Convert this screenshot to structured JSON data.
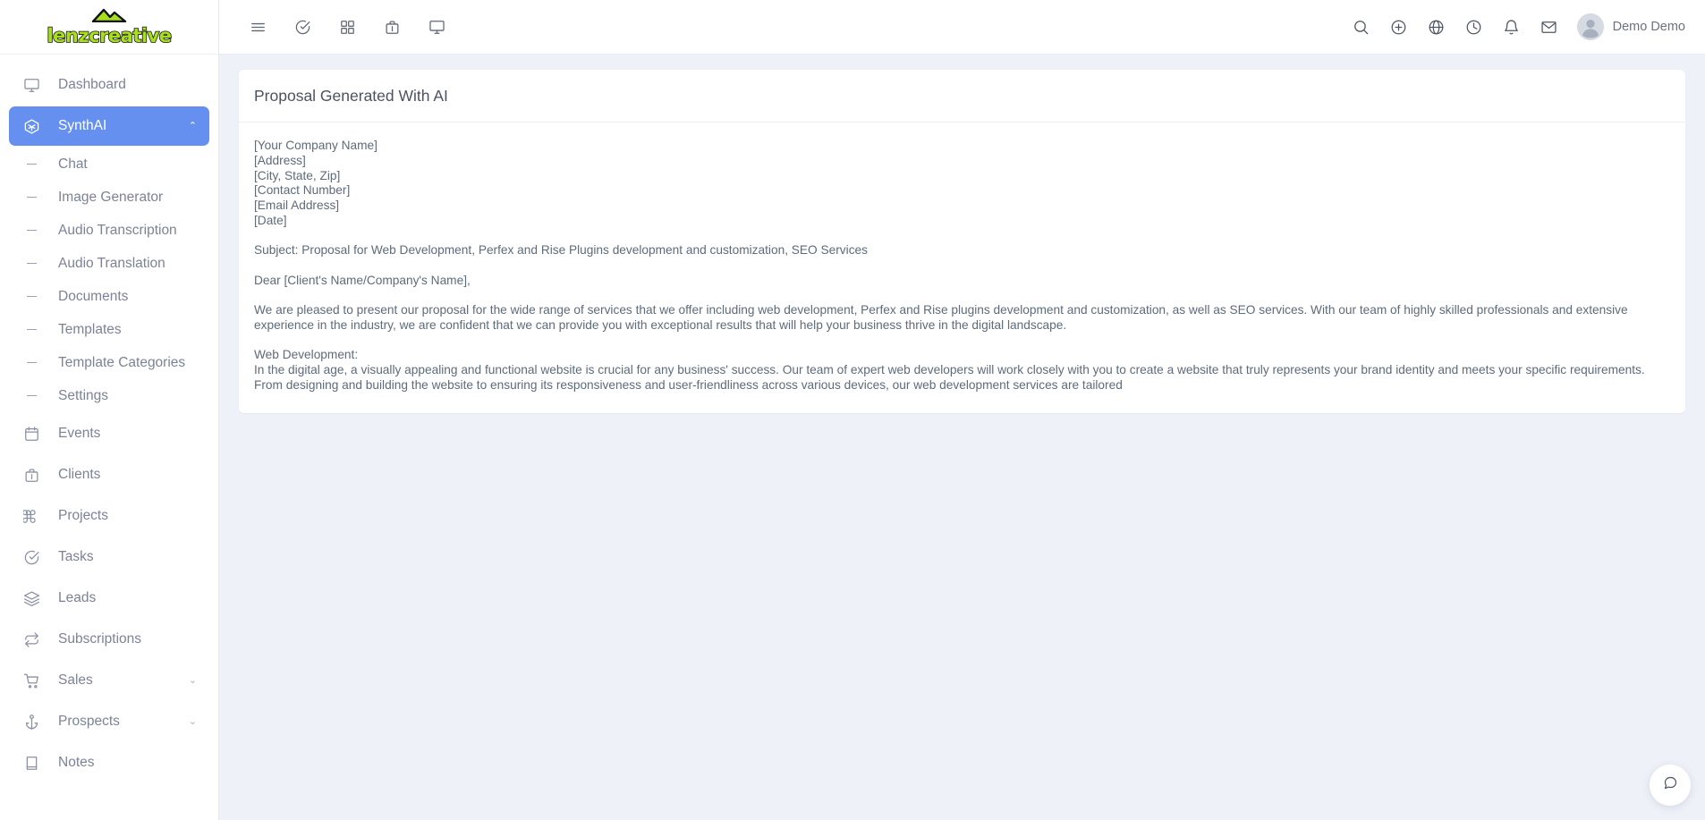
{
  "brand": {
    "logo_text": "lenzcreative",
    "logo_mark": "mountain-icon",
    "logo_color": "#a8e01a",
    "accent_color": "#6690ef"
  },
  "sidebar": {
    "items": [
      {
        "label": "Dashboard",
        "icon": "monitor-icon",
        "type": "item",
        "active": false,
        "caret": ""
      },
      {
        "label": "SynthAI",
        "icon": "cube-icon",
        "type": "item",
        "active": true,
        "caret": "⌃"
      },
      {
        "label": "Chat",
        "icon": "dash-icon",
        "type": "sub",
        "active": false,
        "caret": ""
      },
      {
        "label": "Image Generator",
        "icon": "dash-icon",
        "type": "sub",
        "active": false,
        "caret": ""
      },
      {
        "label": "Audio Transcription",
        "icon": "dash-icon",
        "type": "sub",
        "active": false,
        "caret": ""
      },
      {
        "label": "Audio Translation",
        "icon": "dash-icon",
        "type": "sub",
        "active": false,
        "caret": ""
      },
      {
        "label": "Documents",
        "icon": "dash-icon",
        "type": "sub",
        "active": false,
        "caret": ""
      },
      {
        "label": "Templates",
        "icon": "dash-icon",
        "type": "sub",
        "active": false,
        "caret": ""
      },
      {
        "label": "Template Categories",
        "icon": "dash-icon",
        "type": "sub",
        "active": false,
        "caret": ""
      },
      {
        "label": "Settings",
        "icon": "dash-icon",
        "type": "sub",
        "active": false,
        "caret": ""
      },
      {
        "label": "Events",
        "icon": "calendar-icon",
        "type": "item",
        "active": false,
        "caret": ""
      },
      {
        "label": "Clients",
        "icon": "briefcase-icon",
        "type": "item",
        "active": false,
        "caret": ""
      },
      {
        "label": "Projects",
        "icon": "command-icon",
        "type": "item",
        "active": false,
        "caret": ""
      },
      {
        "label": "Tasks",
        "icon": "check-circle-icon",
        "type": "item",
        "active": false,
        "caret": ""
      },
      {
        "label": "Leads",
        "icon": "layers-icon",
        "type": "item",
        "active": false,
        "caret": ""
      },
      {
        "label": "Subscriptions",
        "icon": "refresh-icon",
        "type": "item",
        "active": false,
        "caret": ""
      },
      {
        "label": "Sales",
        "icon": "cart-icon",
        "type": "item",
        "active": false,
        "caret": "⌄"
      },
      {
        "label": "Prospects",
        "icon": "anchor-icon",
        "type": "item",
        "active": false,
        "caret": "⌄"
      },
      {
        "label": "Notes",
        "icon": "book-icon",
        "type": "item",
        "active": false,
        "caret": ""
      }
    ]
  },
  "topbar": {
    "left_icons": [
      {
        "name": "hamburger-menu-icon",
        "title": "Menu"
      },
      {
        "name": "check-circle-icon",
        "title": "Tasks"
      },
      {
        "name": "grid-icon",
        "title": "Apps"
      },
      {
        "name": "briefcase-icon",
        "title": "Clients"
      },
      {
        "name": "monitor-icon",
        "title": "Dashboard"
      }
    ],
    "right_icons": [
      {
        "name": "search-icon",
        "title": "Search"
      },
      {
        "name": "plus-circle-icon",
        "title": "Add New"
      },
      {
        "name": "globe-icon",
        "title": "Language"
      },
      {
        "name": "clock-icon",
        "title": "Timer"
      },
      {
        "name": "bell-icon",
        "title": "Notifications"
      },
      {
        "name": "mail-icon",
        "title": "Messages"
      }
    ],
    "user": {
      "name": "Demo Demo",
      "avatar": "user-avatar-icon"
    }
  },
  "card": {
    "title": "Proposal Generated With AI",
    "blocks": [
      "[Your Company Name]\n[Address]\n[City, State, Zip]\n[Contact Number]\n[Email Address]\n[Date]",
      "Subject: Proposal for Web Development, Perfex and Rise Plugins development and customization, SEO Services",
      "Dear [Client's Name/Company's Name],",
      "We are pleased to present our proposal for the wide range of services that we offer including web development, Perfex and Rise plugins development and customization, as well as SEO services. With our team of highly skilled professionals and extensive experience in the industry, we are confident that we can provide you with exceptional results that will help your business thrive in the digital landscape.",
      "Web Development:\nIn the digital age, a visually appealing and functional website is crucial for any business' success. Our team of expert web developers will work closely with you to create a website that truly represents your brand identity and meets your specific requirements. From designing and building the website to ensuring its responsiveness and user-friendliness across various devices, our web development services are tailored"
    ]
  },
  "chat_widget": {
    "icon": "chat-bubble-icon",
    "title": "Open chat"
  }
}
